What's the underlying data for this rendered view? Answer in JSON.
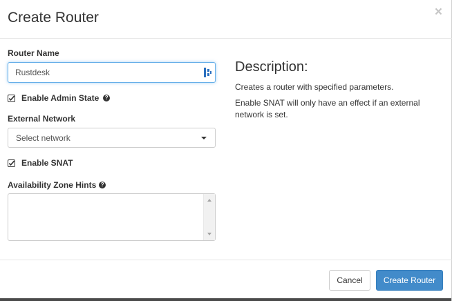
{
  "dialog": {
    "title": "Create Router",
    "close_glyph": "×"
  },
  "form": {
    "router_name": {
      "label": "Router Name",
      "value": "Rustdesk"
    },
    "admin_state": {
      "label": "Enable Admin State",
      "checked": true,
      "help_glyph": "?"
    },
    "external_network": {
      "label": "External Network",
      "selected": "Select network"
    },
    "snat": {
      "label": "Enable SNAT",
      "checked": true
    },
    "availability_zone": {
      "label": "Availability Zone Hints",
      "help_glyph": "?",
      "value": ""
    }
  },
  "description": {
    "title": "Description:",
    "paragraphs": [
      "Creates a router with specified parameters.",
      "Enable SNAT will only have an effect if an external network is set."
    ]
  },
  "footer": {
    "cancel_label": "Cancel",
    "create_label": "Create Router"
  },
  "colors": {
    "primary": "#428bca",
    "focus_border": "#66afe9",
    "text": "#333333"
  },
  "icons": {
    "close": "close-icon",
    "checkbox": "checkbox-checked-icon",
    "help": "question-circle-icon",
    "password_manager": "password-manager-icon",
    "dropdown": "caret-down-icon"
  }
}
